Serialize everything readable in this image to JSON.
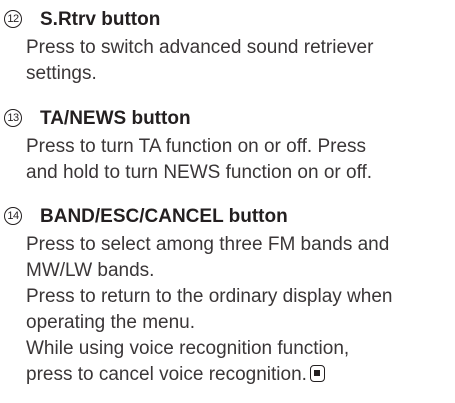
{
  "sections": [
    {
      "number": "12",
      "title": "S.Rtrv button",
      "lines": [
        "Press to switch advanced sound retriever",
        "settings."
      ]
    },
    {
      "number": "13",
      "title": "TA/NEWS button",
      "lines": [
        "Press to turn TA function on or off. Press",
        "and hold to turn NEWS function on or off."
      ]
    },
    {
      "number": "14",
      "title": "BAND/ESC/CANCEL button",
      "lines": [
        "Press to select among three FM bands and",
        "MW/LW bands.",
        "Press to return to the ordinary display when",
        "operating the menu.",
        "While using voice recognition function,",
        "press to cancel voice recognition."
      ]
    }
  ],
  "end_mark_icon": "end-of-section-icon"
}
